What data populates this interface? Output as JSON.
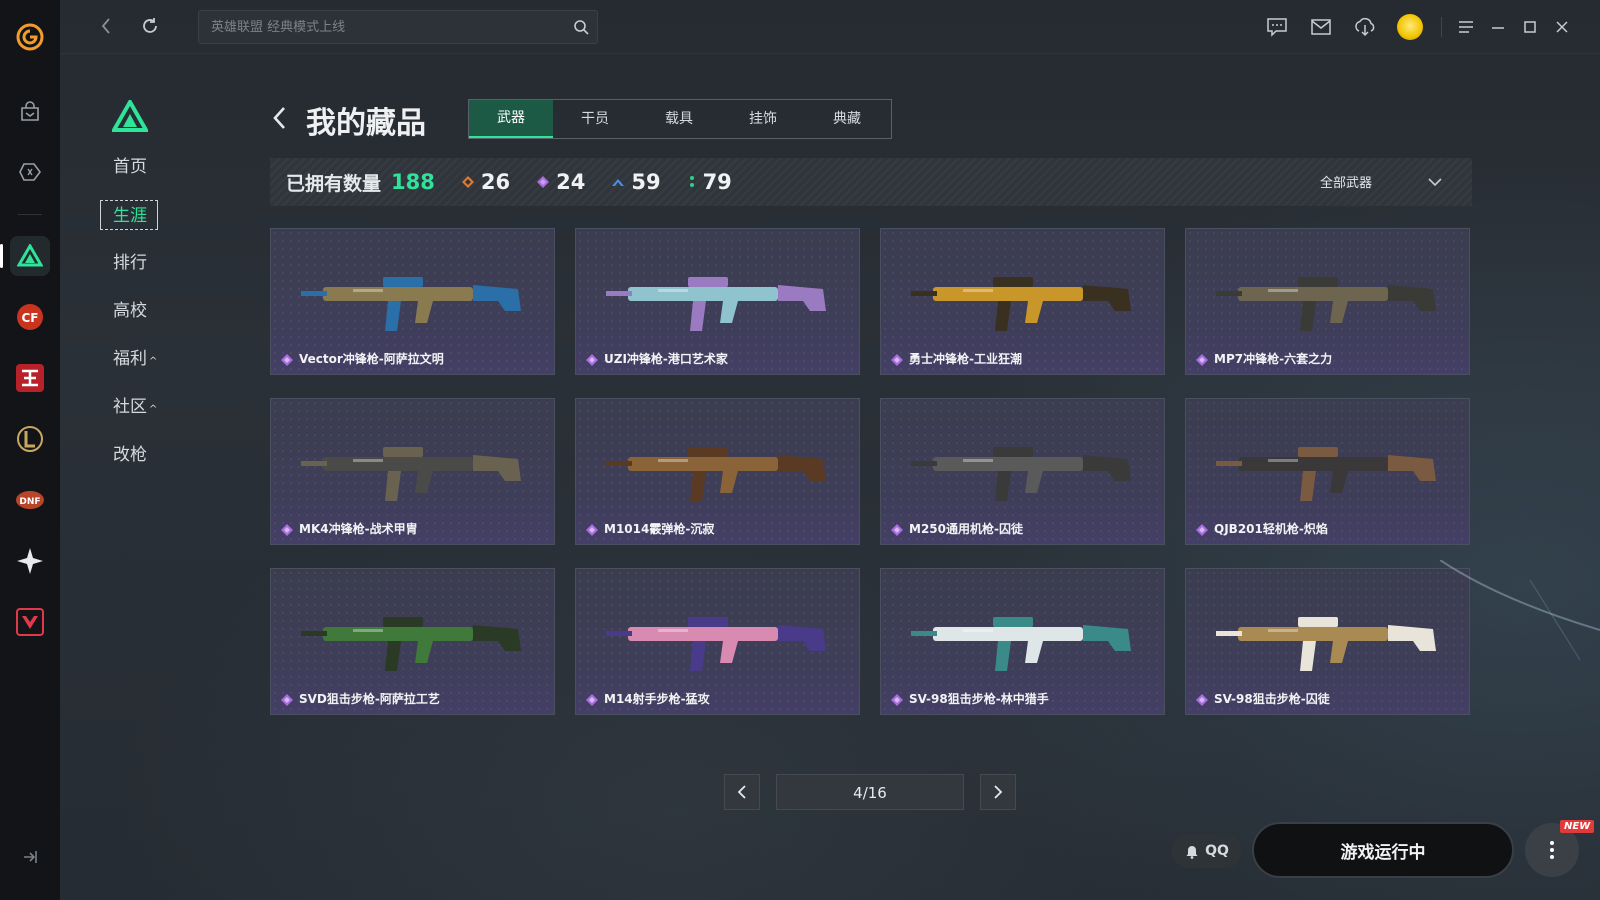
{
  "topbar": {
    "search_placeholder": "英雄联盟 经典模式上线"
  },
  "sidenav": {
    "items": [
      {
        "label": "首页"
      },
      {
        "label": "生涯"
      },
      {
        "label": "排行"
      },
      {
        "label": "高校"
      },
      {
        "label": "福利"
      },
      {
        "label": "社区"
      },
      {
        "label": "改枪"
      }
    ],
    "expand_caret": "^"
  },
  "header": {
    "title": "我的藏品",
    "tabs": [
      {
        "label": "武器"
      },
      {
        "label": "干员"
      },
      {
        "label": "载具"
      },
      {
        "label": "挂饰"
      },
      {
        "label": "典藏"
      }
    ]
  },
  "stats": {
    "owned_label": "已拥有数量",
    "owned_total": "188",
    "tiers": [
      {
        "color": "#e07a2e",
        "count": "26"
      },
      {
        "color": "#a86be0",
        "count": "24"
      },
      {
        "color": "#4a8fe0",
        "count": "59"
      },
      {
        "color": "#2fcf8a",
        "count": "79"
      }
    ],
    "filter_label": "全部武器"
  },
  "items": [
    {
      "name": "Vector冲锋枪-阿萨拉文明",
      "color": "#8a7a50",
      "accent": "#2a6fa8"
    },
    {
      "name": "UZI冲锋枪-港口艺术家",
      "color": "#8fc4cf",
      "accent": "#9a7ac0"
    },
    {
      "name": "勇士冲锋枪-工业狂潮",
      "color": "#c9962a",
      "accent": "#3a3020"
    },
    {
      "name": "MP7冲锋枪-六套之力",
      "color": "#6d6550",
      "accent": "#3a3a36"
    },
    {
      "name": "MK4冲锋枪-战术甲胄",
      "color": "#4a4a48",
      "accent": "#6a6250"
    },
    {
      "name": "M1014霰弹枪-沉寂",
      "color": "#8a6438",
      "accent": "#5a3a22"
    },
    {
      "name": "M250通用机枪-囚徒",
      "color": "#5a5a5a",
      "accent": "#3a3a3a"
    },
    {
      "name": "QJB201轻机枪-炽焰",
      "color": "#3a3838",
      "accent": "#7a5a40"
    },
    {
      "name": "SVD狙击步枪-阿萨拉工艺",
      "color": "#3f7a3a",
      "accent": "#2a3a24"
    },
    {
      "name": "M14射手步枪-猛攻",
      "color": "#d88ab0",
      "accent": "#4a3a8a"
    },
    {
      "name": "SV-98狙击步枪-林中猎手",
      "color": "#dfe6e8",
      "accent": "#3a8a8a"
    },
    {
      "name": "SV-98狙击步枪-囚徒",
      "color": "#a88a52",
      "accent": "#e8e4da"
    }
  ],
  "pagination": {
    "label": "4/16"
  },
  "footer": {
    "qq_label": "QQ",
    "running_label": "游戏运行中",
    "new_badge": "NEW"
  },
  "colors": {
    "accent": "#2fe39a",
    "rarity_purple": "#a86be0"
  }
}
